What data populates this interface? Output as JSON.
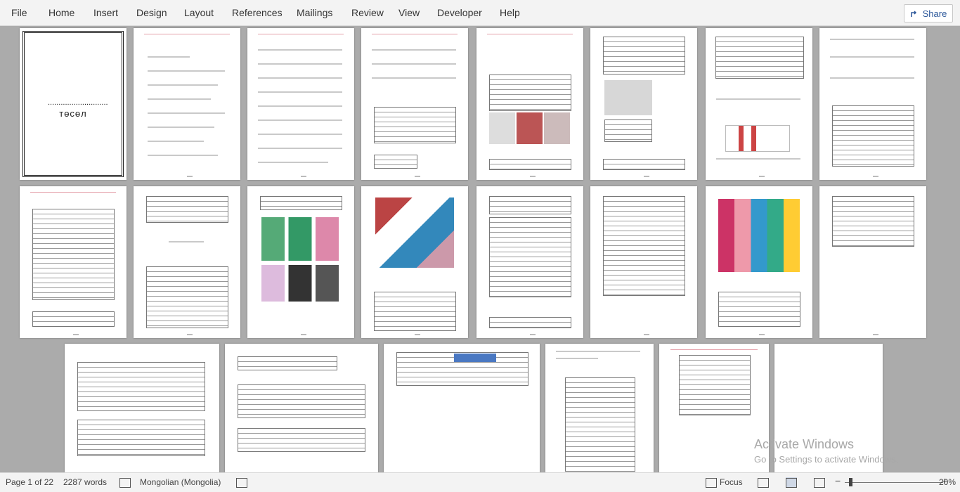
{
  "menu": [
    "File",
    "Home",
    "Insert",
    "Design",
    "Layout",
    "References",
    "Mailings",
    "Review",
    "View",
    "Developer",
    "Help"
  ],
  "share": {
    "label": "Share",
    "icon": "share-icon"
  },
  "document": {
    "cover_title": "төсөл",
    "cover_dots": "............................"
  },
  "status": {
    "page": "Page 1 of 22",
    "words": "2287 words",
    "language": "Mongolian (Mongolia)",
    "focus": "Focus",
    "zoom": "20%",
    "icons": [
      "proofing-icon",
      "accessibility-icon",
      "focus-icon",
      "read-mode-icon",
      "print-layout-icon",
      "web-layout-icon",
      "zoom-out-icon",
      "zoom-slider",
      "zoom-in-icon"
    ]
  },
  "watermark": {
    "line1": "Activate Windows",
    "line2": "Go to Settings to activate Windows."
  },
  "colors": {
    "menubar": "#f3f3f3",
    "canvas": "#ababab",
    "accent": "#2b579a"
  }
}
